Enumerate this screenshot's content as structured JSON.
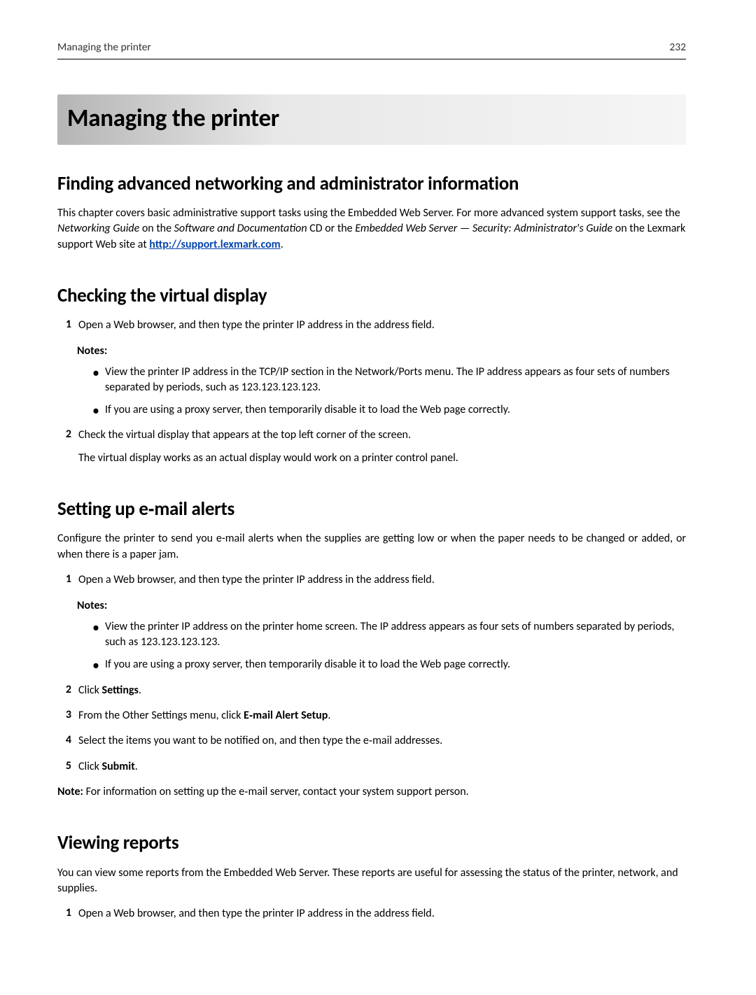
{
  "header": {
    "left": "Managing the printer",
    "right": "232"
  },
  "title": "Managing the printer",
  "section1": {
    "heading": "Finding advanced networking and administrator information",
    "para_pre": "This chapter covers basic administrative support tasks using the Embedded Web Server. For more advanced system support tasks, see the ",
    "em1": "Networking Guide",
    "mid1": " on the ",
    "em2": "Software and Documentation",
    "mid2": " CD or the ",
    "em3": "Embedded Web Server — Security: Administrator's Guide",
    "mid3": " on the Lexmark support Web site at ",
    "link": "http://support.lexmark.com",
    "tail": "."
  },
  "section2": {
    "heading": "Checking the virtual display",
    "step1": "Open a Web browser, and then type the printer IP address in the address field.",
    "notes_label": "Notes:",
    "note1": "View the printer IP address in the TCP/IP section in the Network/Ports menu. The IP address appears as four sets of numbers separated by periods, such as 123.123.123.123.",
    "note2": "If you are using a proxy server, then temporarily disable it to load the Web page correctly.",
    "step2a": "Check the virtual display that appears at the top left corner of the screen.",
    "step2b": "The virtual display works as an actual display would work on a printer control panel."
  },
  "section3": {
    "heading": "Setting up e‑mail alerts",
    "intro": "Configure the printer to send you e-mail alerts when the supplies are getting low or when the paper needs to be changed or added, or when there is a paper jam.",
    "step1": "Open a Web browser, and then type the printer IP address in the address field.",
    "notes_label": "Notes:",
    "note1": "View the printer IP address on the printer home screen. The IP address appears as four sets of numbers separated by periods, such as 123.123.123.123.",
    "note2": "If you are using a proxy server, then temporarily disable it to load the Web page correctly.",
    "step2_pre": "Click ",
    "step2_bold": "Settings",
    "step2_tail": ".",
    "step3_pre": "From the Other Settings menu, click ",
    "step3_bold": "E‑mail Alert Setup",
    "step3_tail": ".",
    "step4": "Select the items you want to be notified on, and then type the e‑mail addresses.",
    "step5_pre": "Click ",
    "step5_bold": "Submit",
    "step5_tail": ".",
    "final_note_bold": "Note:",
    "final_note_text": " For information on setting up the e‑mail server, contact your system support person."
  },
  "section4": {
    "heading": "Viewing reports",
    "intro": "You can view some reports from the Embedded Web Server. These reports are useful for assessing the status of the printer, network, and supplies.",
    "step1": "Open a Web browser, and then type the printer IP address in the address field."
  },
  "nums": {
    "n1": "1",
    "n2": "2",
    "n3": "3",
    "n4": "4",
    "n5": "5"
  }
}
